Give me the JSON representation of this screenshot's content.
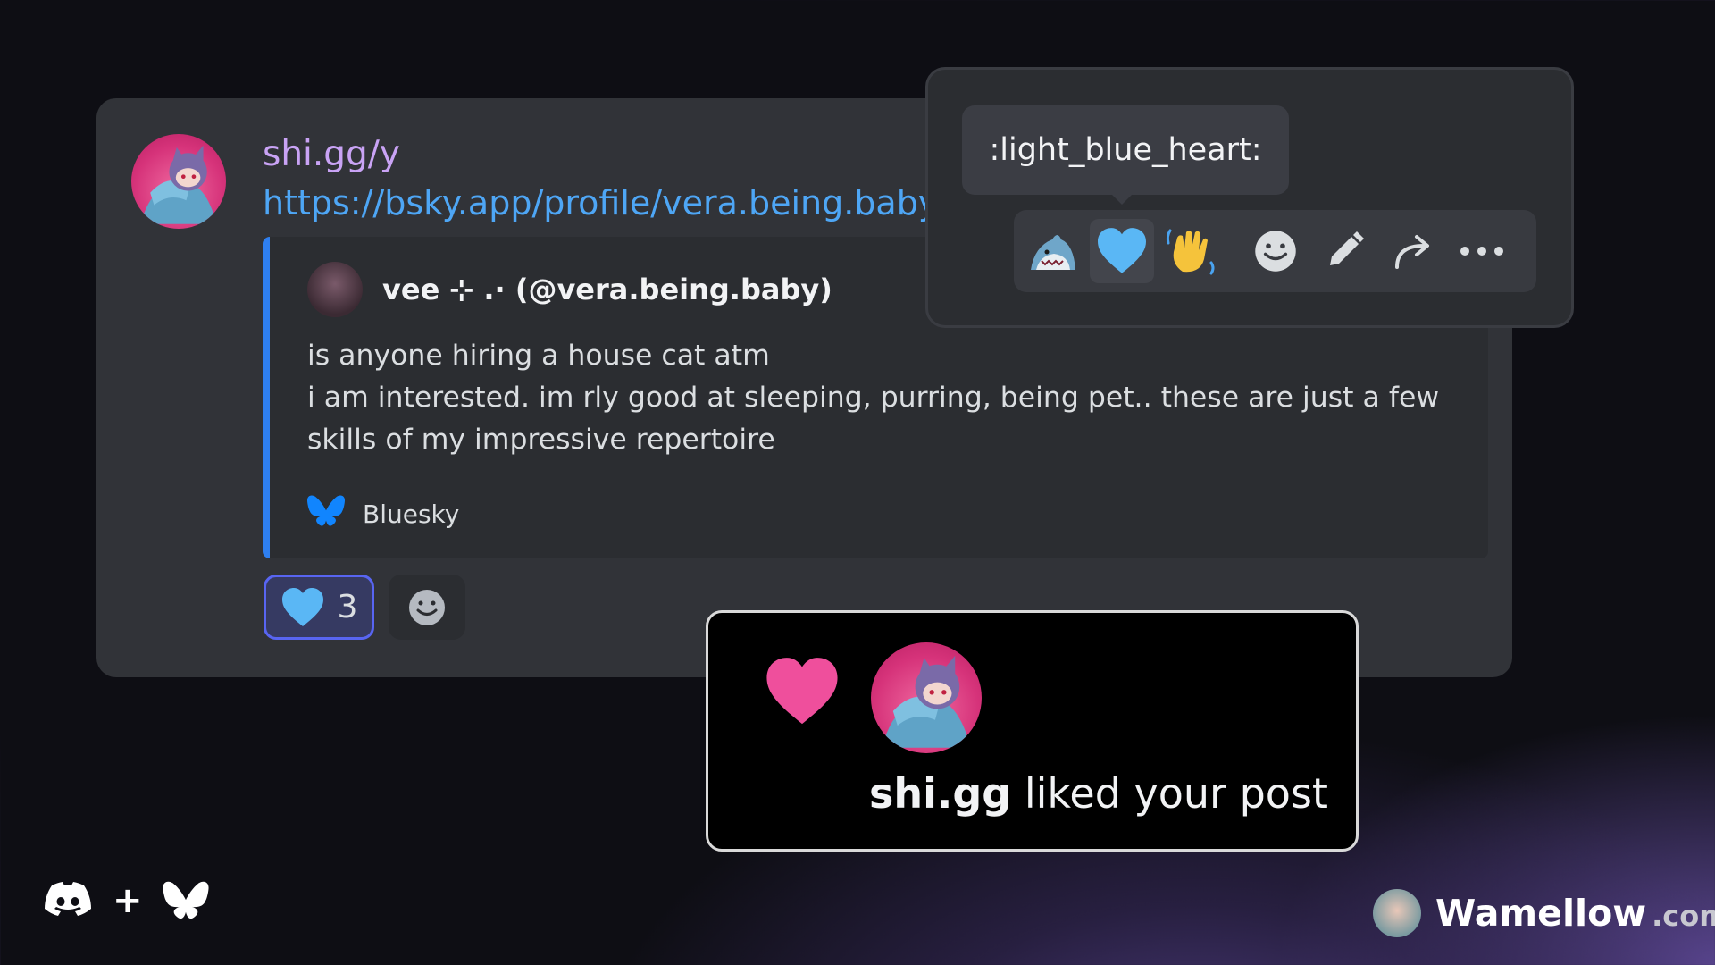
{
  "message": {
    "username": "shi.gg/y",
    "link": "https://bsky.app/profile/vera.being.baby/p"
  },
  "embed": {
    "author": "vee ⊹ .· (@vera.being.baby)",
    "line1": "is anyone hiring a house cat atm",
    "line2": "i am interested. im rly good at sleeping, purring, being pet.. these are just a few skills of my impressive repertoire",
    "footer": "Bluesky"
  },
  "reactions": [
    {
      "emoji": "light-blue-heart",
      "count": "3",
      "active": true
    }
  ],
  "hover_menu": {
    "tooltip": ":light_blue_heart:",
    "quick_reactions": [
      "shark",
      "light-blue-heart",
      "waving-hand"
    ],
    "actions": [
      "add-reaction-icon",
      "edit-icon",
      "reply-icon",
      "more-icon"
    ]
  },
  "notification": {
    "user": "shi.gg",
    "action": "liked your post"
  },
  "branding": {
    "plus": "+",
    "name": "Wamellow",
    "tld": ".com"
  },
  "colors": {
    "link": "#4ea6f5",
    "username": "#c9a3f5",
    "embed_border": "#2e7ff0",
    "heart_blue": "#5ab7f5",
    "heart_pink": "#ef4f9c"
  }
}
